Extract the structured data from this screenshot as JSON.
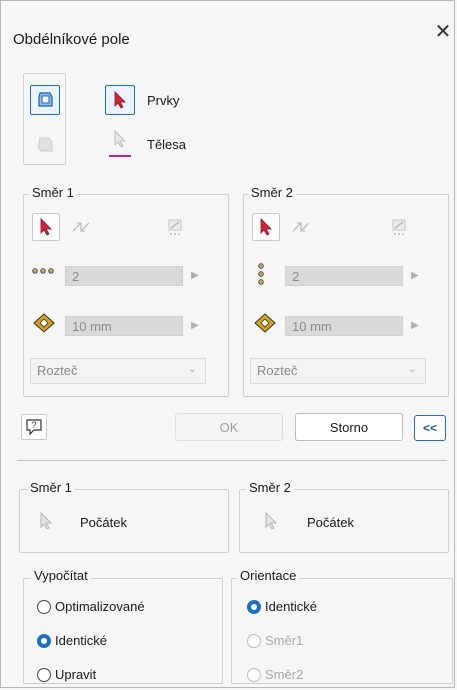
{
  "window": {
    "title": "Obdélníkové pole"
  },
  "input": {
    "items_label": "Prvky",
    "bodies_label": "Tělesa"
  },
  "direction1": {
    "title": "Směr 1",
    "count": "2",
    "distance": "10 mm",
    "method": "Rozteč"
  },
  "direction2": {
    "title": "Směr 2",
    "count": "2",
    "distance": "10 mm",
    "method": "Rozteč"
  },
  "buttons": {
    "ok": "OK",
    "cancel": "Storno",
    "more": "<<"
  },
  "start": {
    "dir1_title": "Směr 1",
    "dir1_label": "Počátek",
    "dir2_title": "Směr 2",
    "dir2_label": "Počátek"
  },
  "compute": {
    "title": "Vypočítat",
    "options": [
      "Optimalizované",
      "Identické",
      "Upravit"
    ],
    "selected": "Identické"
  },
  "orientation": {
    "title": "Orientace",
    "options": [
      "Identické",
      "Směr1",
      "Směr2"
    ],
    "selected": "Identické"
  },
  "colors": {
    "accent": "#1f6fc0",
    "arrow": "#d6223a",
    "bodies_underline": "#c0247f",
    "gold": "#d7a21a"
  }
}
